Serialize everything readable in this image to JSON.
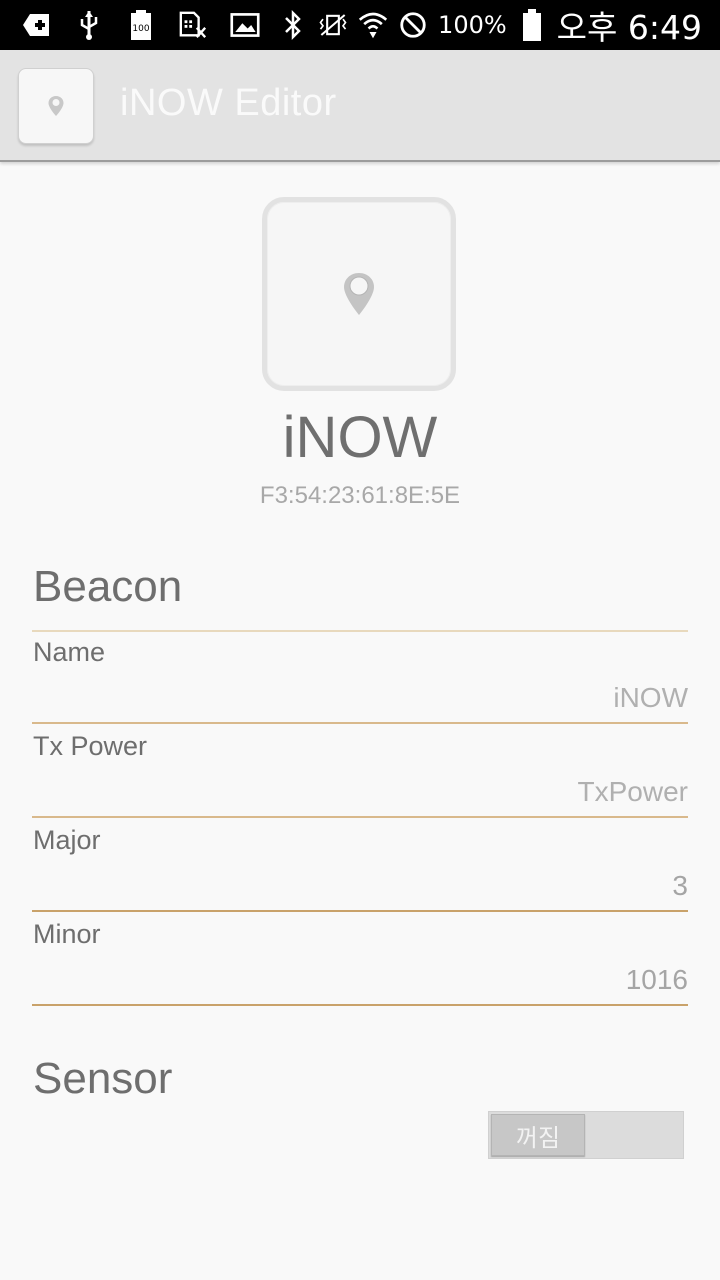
{
  "status_bar": {
    "left_icons": [
      "add-icon",
      "usb-icon",
      "battery-100-badge-icon",
      "sim-off-icon",
      "image-icon"
    ],
    "right_icons": [
      "bluetooth-icon",
      "vibrate-icon",
      "wifi-icon",
      "do-not-disturb-icon"
    ],
    "battery_percent": "100%",
    "time": "오후 6:49"
  },
  "action_bar": {
    "app_icon": "beacon-app-icon",
    "title": "iNOW Editor"
  },
  "device": {
    "icon": "location-pin-icon",
    "name": "iNOW",
    "mac": "F3:54:23:61:8E:5E"
  },
  "beacon_section": {
    "title": "Beacon",
    "fields": [
      {
        "label": "Name",
        "value": "",
        "placeholder": "iNOW"
      },
      {
        "label": "Tx Power",
        "value": "",
        "placeholder": "TxPower"
      },
      {
        "label": "Major",
        "value": "3",
        "placeholder": ""
      },
      {
        "label": "Minor",
        "value": "1016",
        "placeholder": ""
      }
    ]
  },
  "sensor_section": {
    "title": "Sensor",
    "toggle_label": "꺼짐",
    "toggle_on": false
  },
  "colors": {
    "accent_line": "#d9b98c",
    "action_bar": "#e3e3e3",
    "background": "#f9f9f9"
  }
}
